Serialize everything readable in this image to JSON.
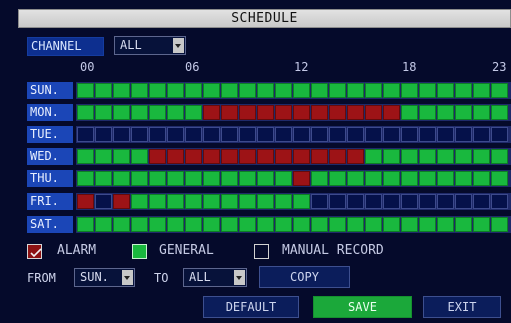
{
  "title": "SCHEDULE",
  "channel": {
    "label": "CHANNEL",
    "value": "ALL"
  },
  "hours": [
    "00",
    "06",
    "12",
    "18",
    "23"
  ],
  "days": [
    {
      "label": "SUN.",
      "pattern": "GGGGGGGGGGGGGGGGGGGGGGGG"
    },
    {
      "label": "MON.",
      "pattern": "GGGGGGGAAAAAAAAAAAGGGGGG"
    },
    {
      "label": "TUE.",
      "pattern": "MMMMMMMMMMMMMMMMMMMMMMMM"
    },
    {
      "label": "WED.",
      "pattern": "GGGGAAAAAAAAAAAAGGGGGGGG"
    },
    {
      "label": "THU.",
      "pattern": "GGGGGGGGGGGGAGGGGGGGGGGG"
    },
    {
      "label": "FRI.",
      "pattern": "AMAGGGGGGGGGGMMMMMMMMMMM"
    },
    {
      "label": "SAT.",
      "pattern": "GGGGGGGGGGGGGGGGGGGGGGGG"
    }
  ],
  "legend": {
    "alarm": "ALARM",
    "general": "GENERAL",
    "manual": "MANUAL RECORD"
  },
  "copy_controls": {
    "from_label": "FROM",
    "from_value": "SUN.",
    "to_label": "TO",
    "to_value": "ALL",
    "copy_label": "COPY"
  },
  "buttons": {
    "default": "DEFAULT",
    "save": "SAVE",
    "exit": "EXIT"
  },
  "colors": {
    "general": "#19b83e",
    "alarm": "#9d1316",
    "manual": "#05114a",
    "accent": "#1b46b7"
  }
}
